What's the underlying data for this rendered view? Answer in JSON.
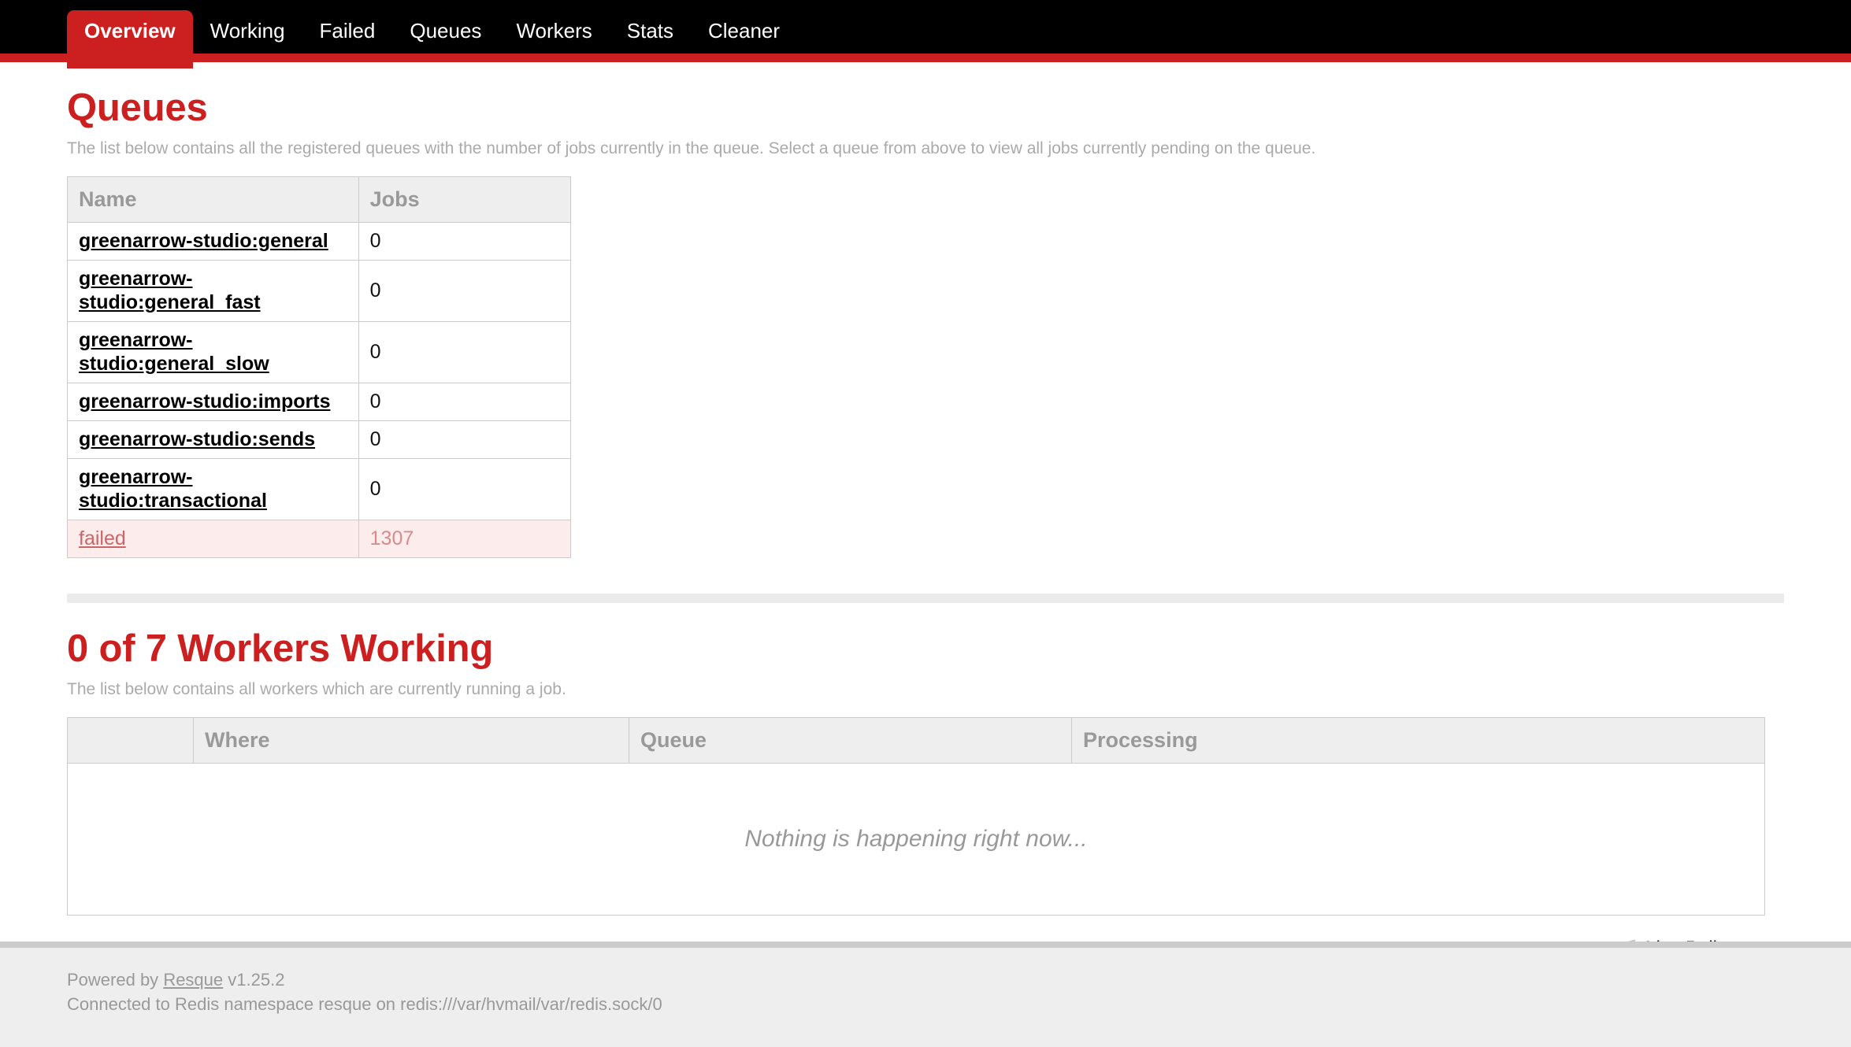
{
  "nav": {
    "tabs": [
      {
        "label": "Overview",
        "active": true
      },
      {
        "label": "Working",
        "active": false
      },
      {
        "label": "Failed",
        "active": false
      },
      {
        "label": "Queues",
        "active": false
      },
      {
        "label": "Workers",
        "active": false
      },
      {
        "label": "Stats",
        "active": false
      },
      {
        "label": "Cleaner",
        "active": false
      }
    ],
    "accent_color": "#cc1f1f",
    "bar_color": "#000000"
  },
  "queues_section": {
    "title": "Queues",
    "description": "The list below contains all the registered queues with the number of jobs currently in the queue. Select a queue from above to view all jobs currently pending on the queue.",
    "columns": [
      "Name",
      "Jobs"
    ],
    "rows": [
      {
        "name": "greenarrow-studio:general",
        "jobs": "0",
        "failed": false
      },
      {
        "name": "greenarrow-studio:general_fast",
        "jobs": "0",
        "failed": false
      },
      {
        "name": "greenarrow-studio:general_slow",
        "jobs": "0",
        "failed": false
      },
      {
        "name": "greenarrow-studio:imports",
        "jobs": "0",
        "failed": false
      },
      {
        "name": "greenarrow-studio:sends",
        "jobs": "0",
        "failed": false
      },
      {
        "name": "greenarrow-studio:transactional",
        "jobs": "0",
        "failed": false
      },
      {
        "name": "failed",
        "jobs": "1307",
        "failed": true
      }
    ]
  },
  "workers_section": {
    "title": "0 of 7 Workers Working",
    "description": "The list below contains all workers which are currently running a job.",
    "columns": [
      "",
      "Where",
      "Queue",
      "Processing"
    ],
    "empty_message": "Nothing is happening right now..."
  },
  "live_poll": {
    "label": "Live Poll",
    "icon": "paper-plane-icon"
  },
  "footer": {
    "powered_prefix": "Powered by",
    "powered_link": "Resque",
    "version": "v1.25.2",
    "connection": "Connected to Redis namespace resque on redis:///var/hvmail/var/redis.sock/0"
  }
}
